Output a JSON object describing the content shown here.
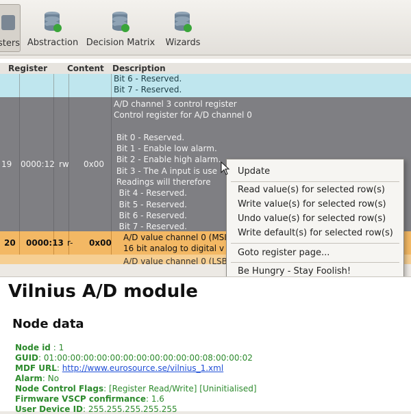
{
  "toolbar": {
    "items": [
      {
        "label": "sters",
        "icon": "registers-icon",
        "active": true
      },
      {
        "label": "Abstraction",
        "icon": "database-icon"
      },
      {
        "label": "Decision Matrix",
        "icon": "database-icon"
      },
      {
        "label": "Wizards",
        "icon": "database-icon"
      }
    ]
  },
  "grid": {
    "headers": [
      "Register",
      "Content",
      "Description"
    ],
    "row_a": {
      "description": "Bit 6 - Reserved.\nBit 7 - Reserved."
    },
    "row_b": {
      "index": "19",
      "register": "0000:12",
      "access": "rw",
      "content": "0x00",
      "description": "A/D channel 3 control register\nControl register for A/D channel 0\n\n Bit 0 - Reserved.\n Bit 1 - Enable low alarm.\n Bit 2 - Enable high alarm.\n Bit 3 - The A input is use\n Readings will therefore\n  Bit 4 - Reserved.\n  Bit 5 - Reserved.\n  Bit 6 - Reserved.\n  Bit 7 - Reserved."
    },
    "row_c": {
      "index": "20",
      "register": "0000:13",
      "access": "r-",
      "content": "0x00",
      "description": "A/D value channel 0 (MSI\n16 bit analog to digital v"
    },
    "row_d": {
      "description": "A/D value channel 0 (LSB"
    }
  },
  "context_menu": {
    "update": "Update",
    "read": "Read value(s) for selected row(s)",
    "write": "Write value(s) for selected row(s)",
    "undo": "Undo value(s) for selected row(s)",
    "write_default": "Write default(s) for selected row(s)",
    "goto": "Goto register page...",
    "about": "Be Hungry - Stay Foolish!"
  },
  "node": {
    "title": "Vilnius A/D module",
    "section": "Node data",
    "node_id_label": "Node id",
    "node_id": " : 1",
    "guid_label": "GUID",
    "guid": ": 01:00:00:00:00:00:00:00:00:00:00:00:08:00:00:02",
    "mdf_label": "MDF URL",
    "mdf_sep": ": ",
    "mdf_url": "http://www.eurosource.se/vilnius_1.xml",
    "alarm_label": "Alarm",
    "alarm": ": No",
    "flags_label": "Node Control Flags",
    "flags": ": [Register Read/Write] [Uninitialised]",
    "firmware_label": "Firmware VSCP confirmance",
    "firmware": ": 1.6",
    "user_id_label": "User Device ID",
    "user_id": ": 255.255.255.255.255"
  },
  "colors": {
    "row_reserved": "#bfe6ee",
    "row_selected": "#7f7f83",
    "row_value": "#f3b864",
    "info_text": "#2c8a2c",
    "link": "#1f4fd6"
  }
}
